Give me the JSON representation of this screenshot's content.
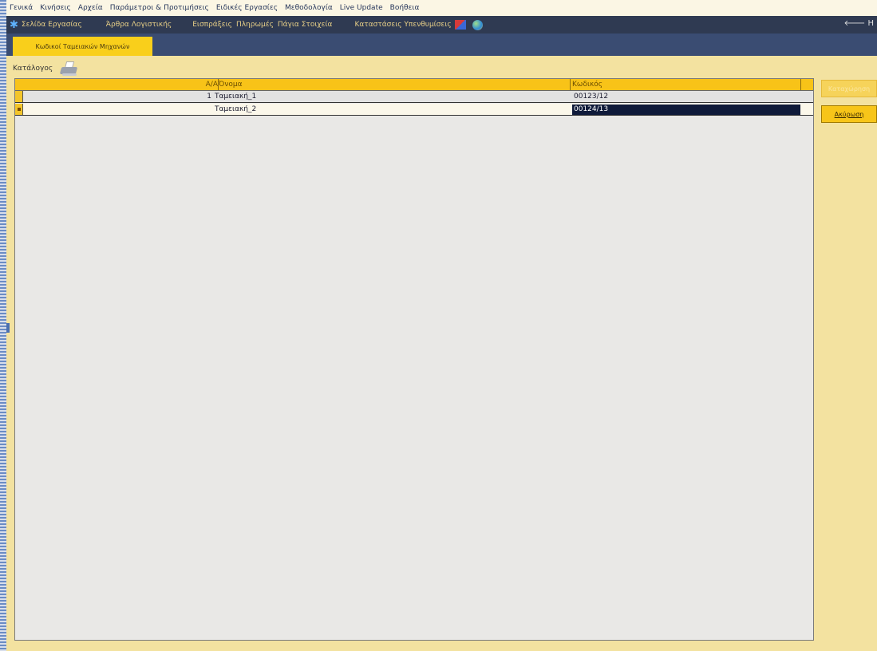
{
  "menubar": {
    "items": [
      "Γενικά",
      "Κινήσεις",
      "Αρχεία",
      "Παράμετροι & Προτιμήσεις",
      "Ειδικές Εργασίες",
      "Μεθοδολογία",
      "Live Update",
      "Βοήθεια"
    ]
  },
  "navbar": {
    "items": [
      "Σελίδα Εργασίας",
      "Άρθρα Λογιστικής",
      "Εισπράξεις",
      "Πληρωμές",
      "Πάγια Στοιχεία",
      "Καταστάσεις Υπενθυμίσεις"
    ],
    "right_label": "H"
  },
  "tabs": {
    "active_label": "Κωδικοί Ταμειακών Μηχανών"
  },
  "toolbar": {
    "catalog_label": "Κατάλογος"
  },
  "grid": {
    "columns": {
      "aa": "Α/Α",
      "name": "Όνομα",
      "code": "Κωδικός"
    },
    "rows": [
      {
        "aa": "1",
        "name": "Ταμειακή_1",
        "code": "00123/12"
      },
      {
        "aa": "",
        "name": "Ταμειακή_2",
        "code": "00124/13"
      }
    ]
  },
  "buttons": {
    "save_label": "Καταχώρηση",
    "cancel_label": "Ακύρωση"
  }
}
